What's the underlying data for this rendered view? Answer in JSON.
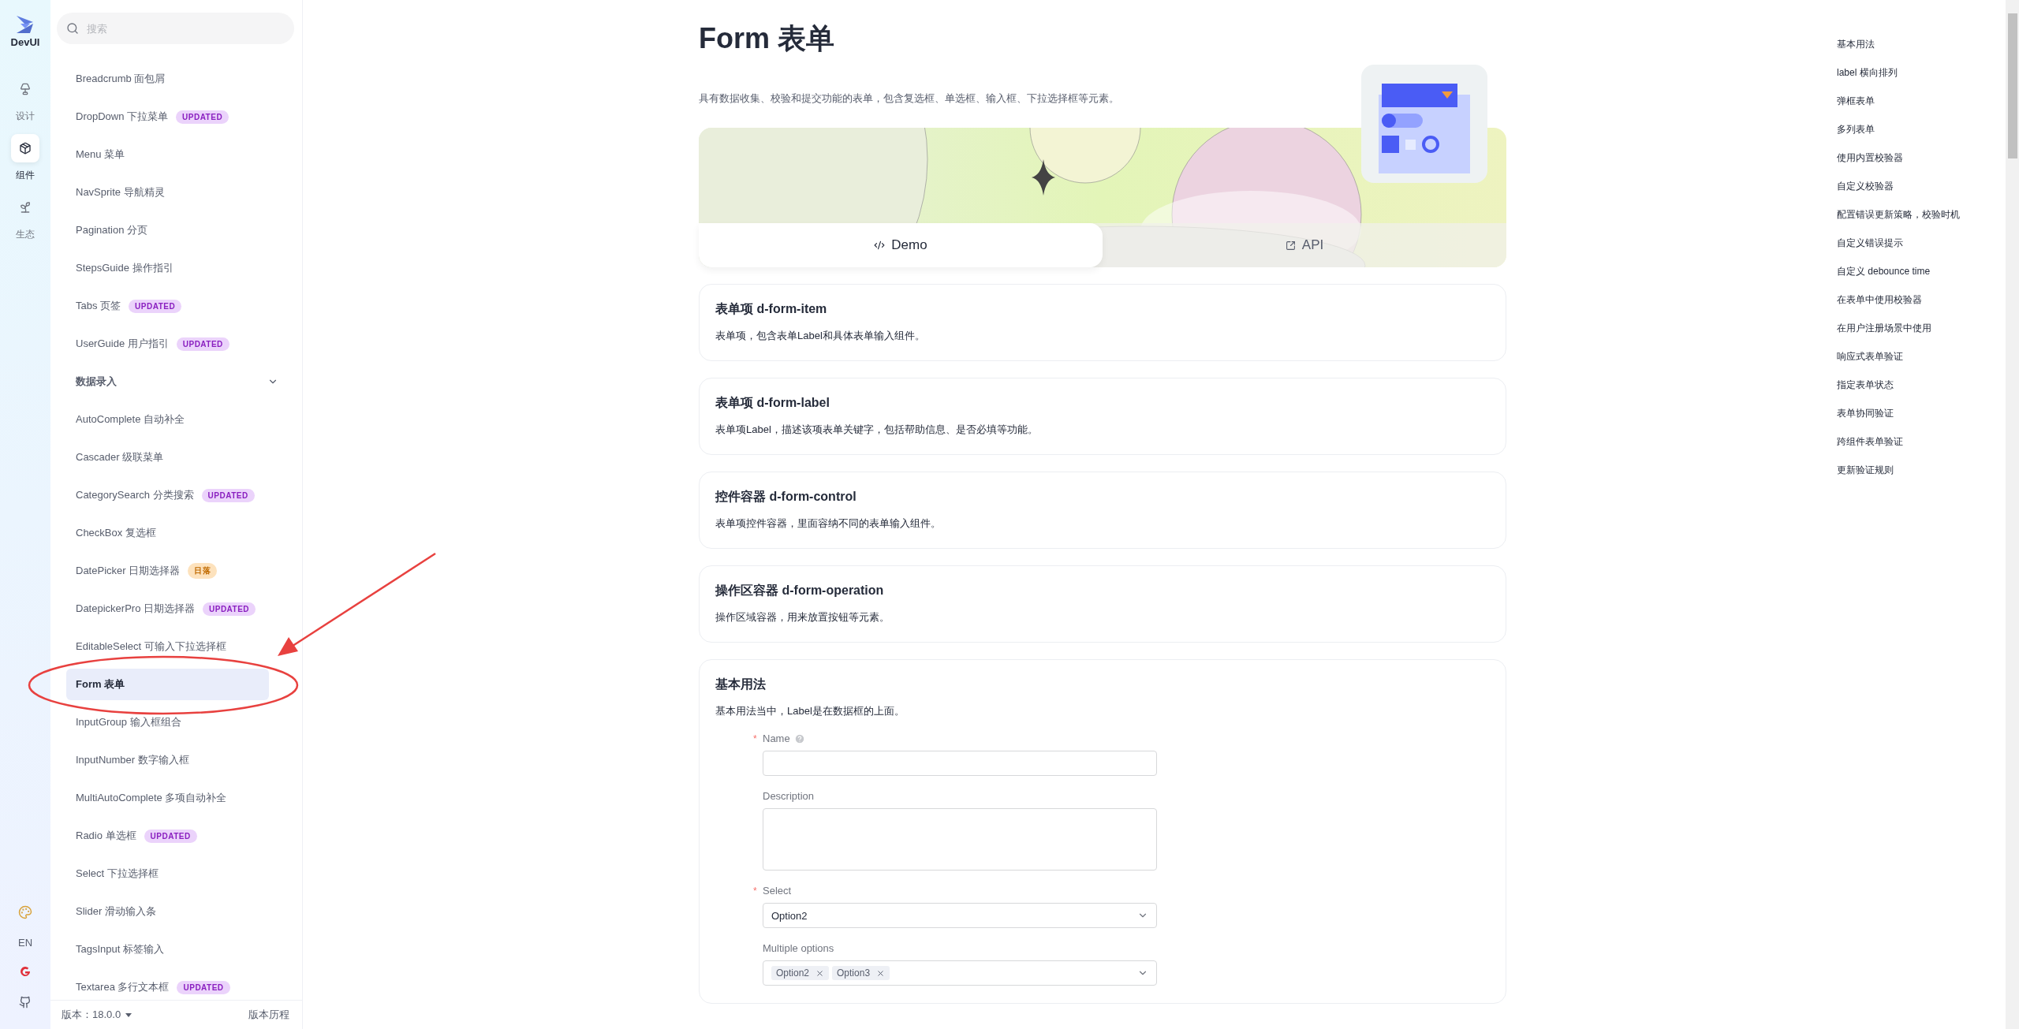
{
  "rail": {
    "logo": "DevUI",
    "items": [
      {
        "label": "设计",
        "selected": false
      },
      {
        "label": "组件",
        "selected": true
      },
      {
        "label": "生态",
        "selected": false
      }
    ],
    "language": "EN"
  },
  "sidebar": {
    "search": {
      "placeholder": "搜索"
    },
    "items": [
      {
        "kind": "link",
        "label": "Breadcrumb 面包屑",
        "selected": false
      },
      {
        "kind": "link",
        "label": "DropDown 下拉菜单",
        "selected": false,
        "badge": {
          "text": "UPDATED",
          "kind": "updated"
        }
      },
      {
        "kind": "link",
        "label": "Menu 菜单",
        "selected": false
      },
      {
        "kind": "link",
        "label": "NavSprite 导航精灵",
        "selected": false
      },
      {
        "kind": "link",
        "label": "Pagination 分页",
        "selected": false
      },
      {
        "kind": "link",
        "label": "StepsGuide 操作指引",
        "selected": false
      },
      {
        "kind": "link",
        "label": "Tabs 页签",
        "selected": false,
        "badge": {
          "text": "UPDATED",
          "kind": "updated"
        }
      },
      {
        "kind": "link",
        "label": "UserGuide 用户指引",
        "selected": false,
        "badge": {
          "text": "UPDATED",
          "kind": "updated"
        }
      },
      {
        "kind": "group",
        "label": "数据录入",
        "expanded": true
      },
      {
        "kind": "link",
        "label": "AutoComplete 自动补全",
        "selected": false
      },
      {
        "kind": "link",
        "label": "Cascader 级联菜单",
        "selected": false
      },
      {
        "kind": "link",
        "label": "CategorySearch 分类搜索",
        "selected": false,
        "badge": {
          "text": "UPDATED",
          "kind": "updated"
        }
      },
      {
        "kind": "link",
        "label": "CheckBox 复选框",
        "selected": false
      },
      {
        "kind": "link",
        "label": "DatePicker 日期选择器",
        "selected": false,
        "badge": {
          "text": "日落",
          "kind": "sunset"
        }
      },
      {
        "kind": "link",
        "label": "DatepickerPro 日期选择器",
        "selected": false,
        "badge": {
          "text": "UPDATED",
          "kind": "updated"
        }
      },
      {
        "kind": "link",
        "label": "EditableSelect 可输入下拉选择框",
        "selected": false
      },
      {
        "kind": "link",
        "label": "Form 表单",
        "selected": true
      },
      {
        "kind": "link",
        "label": "InputGroup 输入框组合",
        "selected": false
      },
      {
        "kind": "link",
        "label": "InputNumber 数字输入框",
        "selected": false
      },
      {
        "kind": "link",
        "label": "MultiAutoComplete 多项自动补全",
        "selected": false
      },
      {
        "kind": "link",
        "label": "Radio 单选框",
        "selected": false,
        "badge": {
          "text": "UPDATED",
          "kind": "updated"
        }
      },
      {
        "kind": "link",
        "label": "Select 下拉选择框",
        "selected": false
      },
      {
        "kind": "link",
        "label": "Slider 滑动输入条",
        "selected": false
      },
      {
        "kind": "link",
        "label": "TagsInput 标签输入",
        "selected": false
      },
      {
        "kind": "link",
        "label": "Textarea 多行文本框",
        "selected": false,
        "badge": {
          "text": "UPDATED",
          "kind": "updated"
        }
      }
    ],
    "footer": {
      "version": "版本：18.0.0",
      "history": "版本历程"
    }
  },
  "page": {
    "title": "Form 表单",
    "description": "具有数据收集、校验和提交功能的表单，包含复选框、单选框、输入框、下拉选择框等元素。",
    "tabs": [
      {
        "label": "Demo",
        "selected": true
      },
      {
        "label": "API",
        "selected": false
      }
    ],
    "sections": [
      {
        "title": "表单项 d-form-item",
        "description": "表单项，包含表单Label和具体表单输入组件。"
      },
      {
        "title": "表单项 d-form-label",
        "description": "表单项Label，描述该项表单关键字，包括帮助信息、是否必填等功能。"
      },
      {
        "title": "控件容器 d-form-control",
        "description": "表单项控件容器，里面容纳不同的表单输入组件。"
      },
      {
        "title": "操作区容器 d-form-operation",
        "description": "操作区域容器，用来放置按钮等元素。"
      }
    ],
    "demo": {
      "title": "基本用法",
      "description": "基本用法当中，Label是在数据框的上面。",
      "required_mark": "*",
      "fields": [
        {
          "kind": "input",
          "label": "Name",
          "required": true,
          "help": true
        },
        {
          "kind": "textarea",
          "label": "Description",
          "required": false
        },
        {
          "kind": "select",
          "label": "Select",
          "required": true,
          "value": "Option2"
        },
        {
          "kind": "multiselect",
          "label": "Multiple options",
          "required": false,
          "tags": [
            "Option2",
            "Option3"
          ]
        }
      ]
    }
  },
  "toc": [
    "基本用法",
    "label 横向排列",
    "弹框表单",
    "多列表单",
    "使用内置校验器",
    "自定义校验器",
    "配置错误更新策略，校验时机",
    "自定义错误提示",
    "自定义 debounce time",
    "在表单中使用校验器",
    "在用户注册场景中使用",
    "响应式表单验证",
    "指定表单状态",
    "表单协同验证",
    "跨组件表单验证",
    "更新验证规则"
  ]
}
